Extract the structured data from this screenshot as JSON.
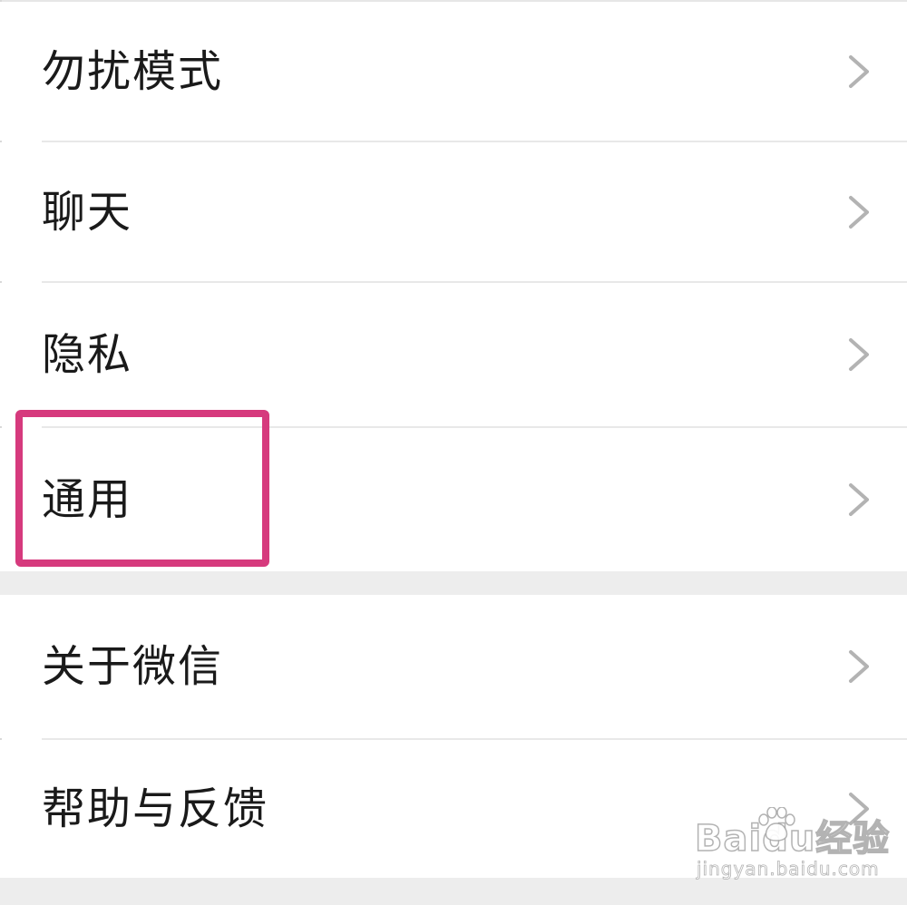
{
  "settings": {
    "items": [
      {
        "label": "勿扰模式"
      },
      {
        "label": "聊天"
      },
      {
        "label": "隐私"
      },
      {
        "label": "通用"
      },
      {
        "label": "关于微信"
      },
      {
        "label": "帮助与反馈"
      }
    ]
  },
  "watermark": {
    "brand": "Baidu经验",
    "url": "jingyan.baidu.com"
  },
  "colors": {
    "highlight": "#d63a7d",
    "chevron": "#b3b3b3",
    "divider": "#e8e8e8",
    "section_gap": "#ededed",
    "text": "#1a1a1a"
  },
  "icons": {
    "row_chevron": "chevron-right-icon",
    "watermark_logo": "paw-icon"
  }
}
